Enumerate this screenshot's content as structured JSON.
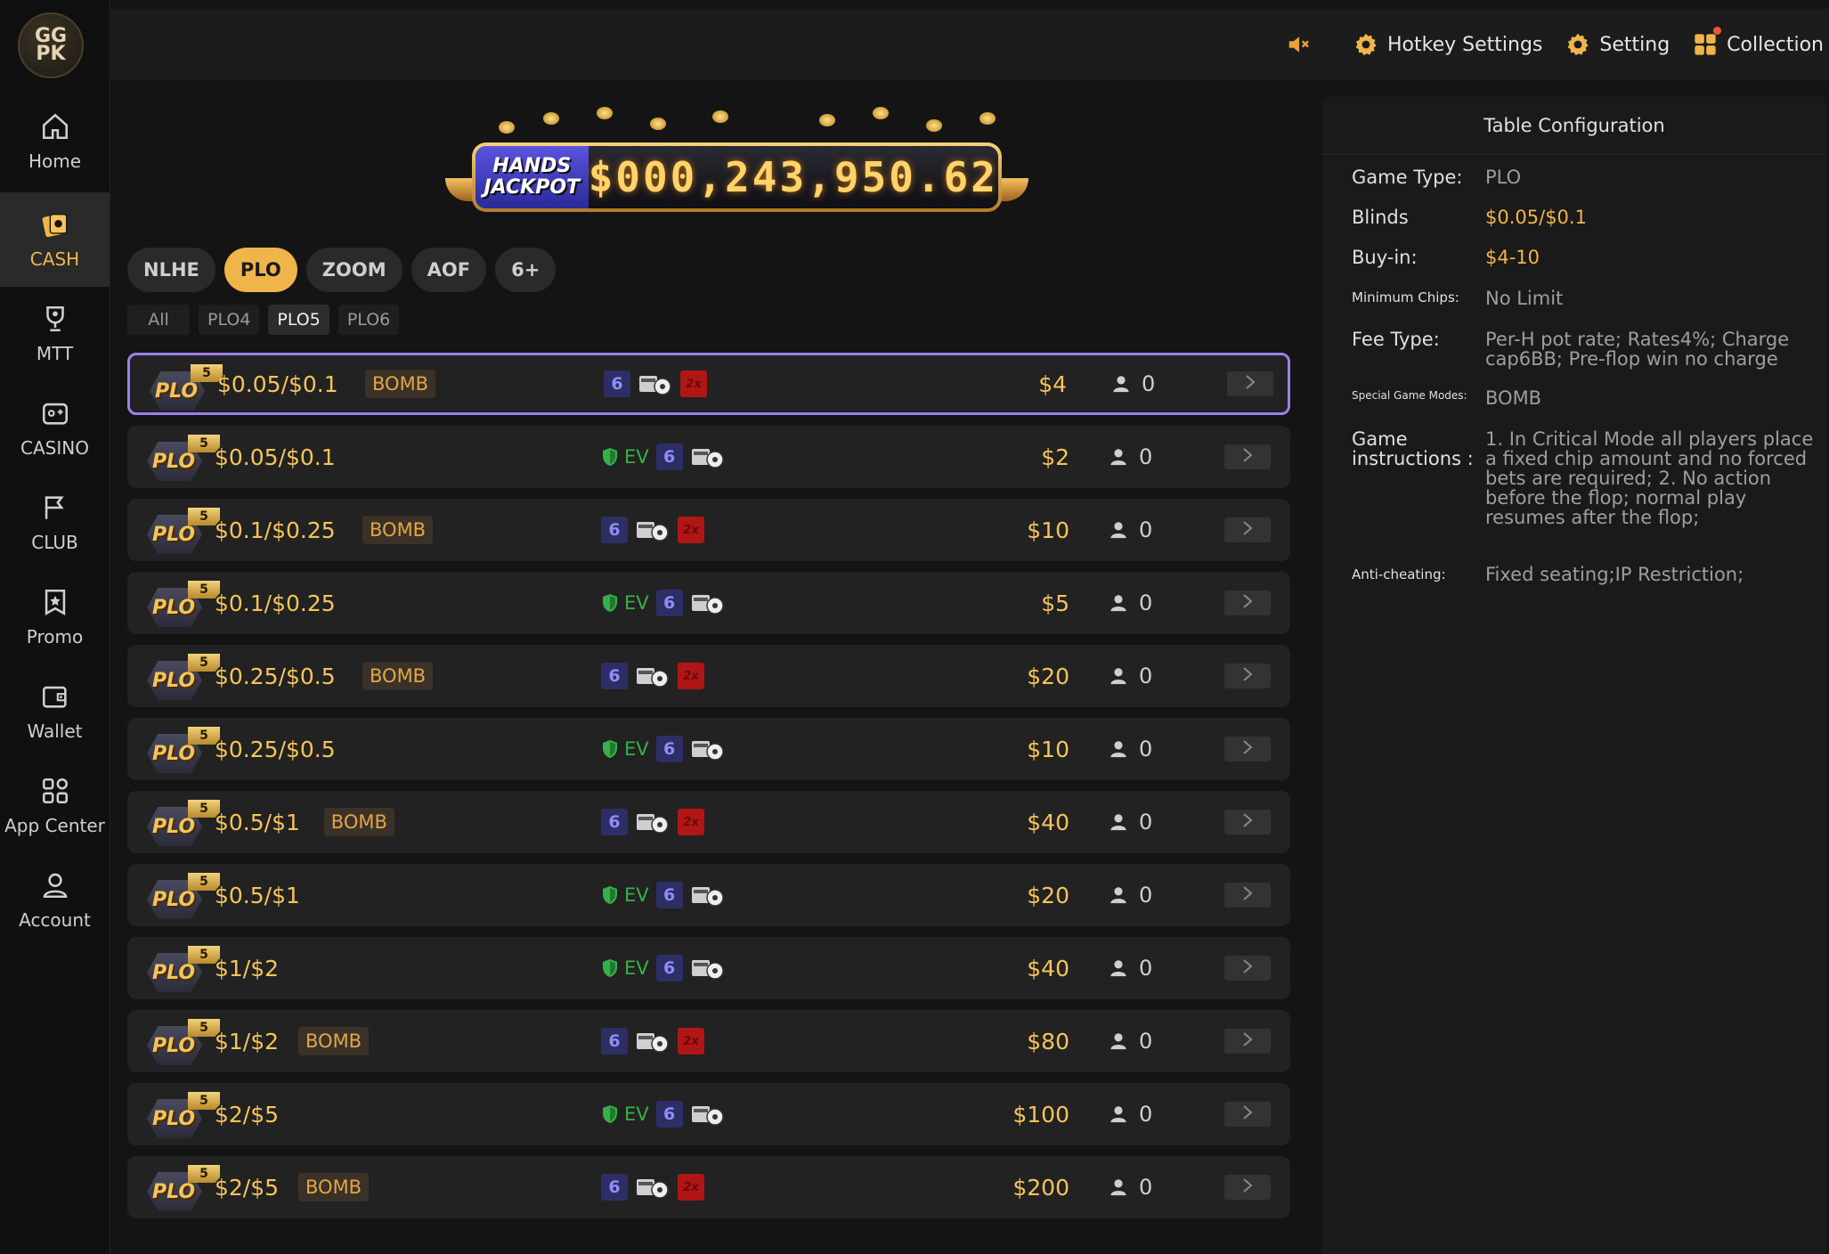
{
  "logo": {
    "text": "GG PK"
  },
  "sidebar": {
    "items": [
      {
        "label": "Home",
        "icon": "home-icon",
        "active": false
      },
      {
        "label": "CASH",
        "icon": "cash-icon",
        "active": true
      },
      {
        "label": "MTT",
        "icon": "trophy-icon",
        "active": false
      },
      {
        "label": "CASINO",
        "icon": "casino-icon",
        "active": false
      },
      {
        "label": "CLUB",
        "icon": "flag-icon",
        "active": false
      },
      {
        "label": "Promo",
        "icon": "promo-icon",
        "active": false
      },
      {
        "label": "Wallet",
        "icon": "wallet-icon",
        "active": false
      },
      {
        "label": "App Center",
        "icon": "app-grid-icon",
        "active": false
      },
      {
        "label": "Account",
        "icon": "user-icon",
        "active": false
      }
    ]
  },
  "topbar": {
    "hotkey_label": "Hotkey Settings",
    "setting_label": "Setting",
    "collection_label": "Collection"
  },
  "jackpot": {
    "label_line1": "HANDS",
    "label_line2": "JACKPOT",
    "value": "$000,243,950.62"
  },
  "tabs": [
    {
      "label": "NLHE",
      "active": false
    },
    {
      "label": "PLO",
      "active": true
    },
    {
      "label": "ZOOM",
      "active": false
    },
    {
      "label": "AOF",
      "active": false
    },
    {
      "label": "6+",
      "active": false
    }
  ],
  "subtabs": [
    {
      "label": "All",
      "active": false
    },
    {
      "label": "PLO4",
      "active": false
    },
    {
      "label": "PLO5",
      "active": true
    },
    {
      "label": "PLO6",
      "active": false
    }
  ],
  "table_rows": [
    {
      "badge": "PLO",
      "badge_num": "5",
      "blinds": "$0.05/$0.1",
      "bomb": "BOMB",
      "ev": "",
      "seats": "6",
      "x2": "2x",
      "buyin": "$4",
      "players": "0",
      "selected": true
    },
    {
      "badge": "PLO",
      "badge_num": "5",
      "blinds": "$0.05/$0.1",
      "bomb": "",
      "ev": "EV",
      "seats": "6",
      "x2": "",
      "buyin": "$2",
      "players": "0",
      "selected": false
    },
    {
      "badge": "PLO",
      "badge_num": "5",
      "blinds": "$0.1/$0.25",
      "bomb": "BOMB",
      "ev": "",
      "seats": "6",
      "x2": "2x",
      "buyin": "$10",
      "players": "0",
      "selected": false
    },
    {
      "badge": "PLO",
      "badge_num": "5",
      "blinds": "$0.1/$0.25",
      "bomb": "",
      "ev": "EV",
      "seats": "6",
      "x2": "",
      "buyin": "$5",
      "players": "0",
      "selected": false
    },
    {
      "badge": "PLO",
      "badge_num": "5",
      "blinds": "$0.25/$0.5",
      "bomb": "BOMB",
      "ev": "",
      "seats": "6",
      "x2": "2x",
      "buyin": "$20",
      "players": "0",
      "selected": false
    },
    {
      "badge": "PLO",
      "badge_num": "5",
      "blinds": "$0.25/$0.5",
      "bomb": "",
      "ev": "EV",
      "seats": "6",
      "x2": "",
      "buyin": "$10",
      "players": "0",
      "selected": false
    },
    {
      "badge": "PLO",
      "badge_num": "5",
      "blinds": "$0.5/$1",
      "bomb": "BOMB",
      "ev": "",
      "seats": "6",
      "x2": "2x",
      "buyin": "$40",
      "players": "0",
      "selected": false
    },
    {
      "badge": "PLO",
      "badge_num": "5",
      "blinds": "$0.5/$1",
      "bomb": "",
      "ev": "EV",
      "seats": "6",
      "x2": "",
      "buyin": "$20",
      "players": "0",
      "selected": false
    },
    {
      "badge": "PLO",
      "badge_num": "5",
      "blinds": "$1/$2",
      "bomb": "",
      "ev": "EV",
      "seats": "6",
      "x2": "",
      "buyin": "$40",
      "players": "0",
      "selected": false
    },
    {
      "badge": "PLO",
      "badge_num": "5",
      "blinds": "$1/$2",
      "bomb": "BOMB",
      "ev": "",
      "seats": "6",
      "x2": "2x",
      "buyin": "$80",
      "players": "0",
      "selected": false
    },
    {
      "badge": "PLO",
      "badge_num": "5",
      "blinds": "$2/$5",
      "bomb": "",
      "ev": "EV",
      "seats": "6",
      "x2": "",
      "buyin": "$100",
      "players": "0",
      "selected": false
    },
    {
      "badge": "PLO",
      "badge_num": "5",
      "blinds": "$2/$5",
      "bomb": "BOMB",
      "ev": "",
      "seats": "6",
      "x2": "2x",
      "buyin": "$200",
      "players": "0",
      "selected": false
    }
  ],
  "config": {
    "title": "Table Configuration",
    "game_type_label": "Game Type:",
    "game_type": "PLO",
    "blinds_label": "Blinds",
    "blinds": "$0.05/$0.1",
    "buyin_label": "Buy-in:",
    "buyin": "$4-10",
    "min_chips_label": "Minimum Chips:",
    "min_chips": "No Limit",
    "fee_label": "Fee Type:",
    "fee": "Per-H pot rate; Rates4%; Charge cap6BB; Pre-flop win no charge",
    "special_label": "Special Game Modes:",
    "special": "BOMB",
    "instructions_label": "Game instructions :",
    "instructions": "1. In Critical Mode all players place a fixed chip amount and no forced bets are required; 2. No action before the flop; normal play resumes after the flop;",
    "anticheat_label": "Anti-cheating:",
    "anticheat": "Fixed seating;IP Restriction;"
  },
  "colors": {
    "accent": "#f0b54a",
    "selected_border": "#9d80ee",
    "ev_green": "#36b04a",
    "bomb_red": "#b01616"
  }
}
